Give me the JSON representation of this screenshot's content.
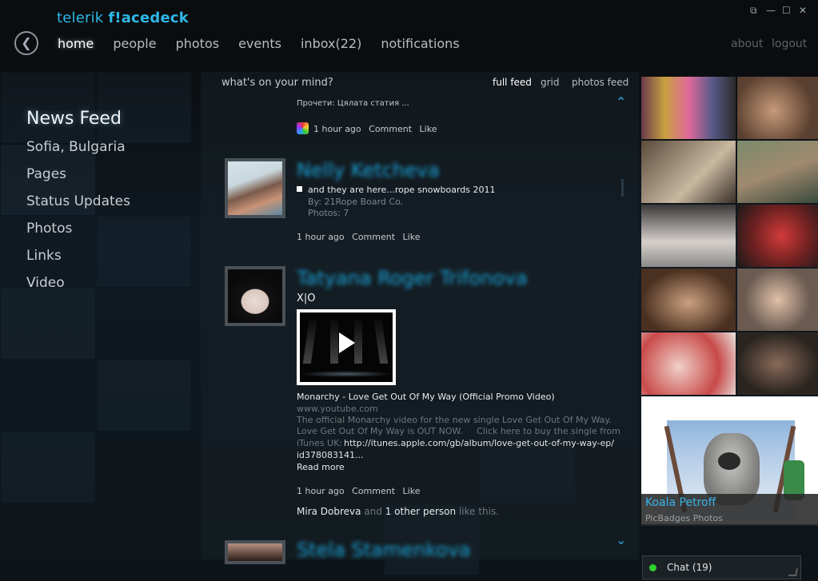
{
  "app": {
    "logo_prefix": "telerik ",
    "logo_brand": "f!acedeck"
  },
  "window_controls": {
    "restore": "⧉",
    "minimize": "—",
    "maximize": "☐",
    "close": "✕"
  },
  "topnav": {
    "home": "home",
    "people": "people",
    "photos": "photos",
    "events": "events",
    "inbox": "inbox(22)",
    "notifications": "notifications"
  },
  "rightnav": {
    "about": "about",
    "logout": "logout"
  },
  "sidebar": {
    "title": "News Feed",
    "items": [
      "Sofia, Bulgaria",
      "Pages",
      "Status Updates",
      "Photos",
      "Links",
      "Video"
    ]
  },
  "feed_header": {
    "mind": "what's on your mind?",
    "full_feed": "full feed",
    "grid": "grid",
    "photos_feed": "photos feed"
  },
  "post0": {
    "read_full": "Прочети: Цялата статия ...",
    "time": "1 hour ago",
    "comment": "Comment",
    "like": "Like"
  },
  "post1": {
    "author": "Nelly Ketcheva",
    "text": "and they are here...rope snowboards 2011",
    "by": "By: 21Rope Board Co.",
    "photos": "Photos: 7",
    "time": "1 hour ago",
    "comment": "Comment",
    "like": "Like"
  },
  "post2": {
    "author": "Tatyana Roger Trifonova",
    "status": "X|O",
    "video_title": "Monarchy - Love Get Out Of My Way (Official Promo Video)",
    "domain": "www.youtube.com",
    "desc1": "The official Monarchy video for the new single Love Get Out Of My Way.",
    "desc2": "Love Get Out Of My Way is OUT NOW.     Click here to buy the single from",
    "desc3_prefix": "iTunes UK:",
    "desc3_link": "http://itunes.apple.com/gb/album/love-get-out-of-my-way-ep/",
    "desc4": "id378083141...",
    "read_more": "Read more",
    "time": "1 hour ago",
    "comment": "Comment",
    "like": "Like",
    "liker": "Mira Dobreva",
    "and": "and",
    "others": "1 other person",
    "like_this": "like this."
  },
  "post3": {
    "author": "Stela Stamenkova"
  },
  "badge": {
    "name": "Koala Petroff",
    "source": "PicBadges Photos"
  },
  "chat": {
    "label": "Chat (19)",
    "status_color": "#2ed02e"
  },
  "colors": {
    "accent": "#1aa3d8",
    "logo": "#2fb8e6"
  }
}
